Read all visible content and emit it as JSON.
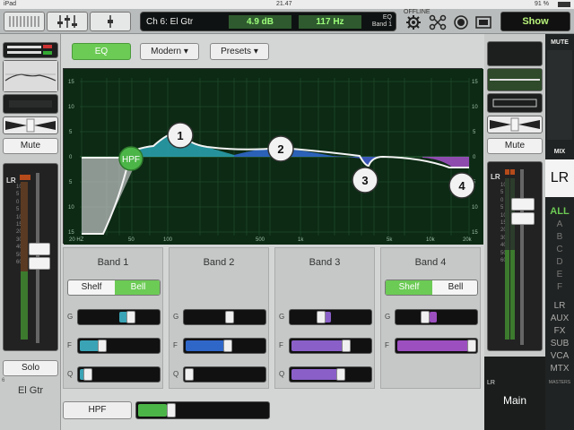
{
  "status_bar": {
    "device": "iPad",
    "time": "21.47",
    "battery": "91 %"
  },
  "top_bar": {
    "channel_name": "Ch 6: El Gtr",
    "gain": "4.9 dB",
    "frequency": "117 Hz",
    "eq_label": "EQ",
    "band_label": "Band 1",
    "offline": "OFFLINE",
    "show_label": "Show"
  },
  "left_strip": {
    "mute_label": "Mute",
    "meter_label": "LR",
    "solo_label": "Solo",
    "channel_number": "6",
    "channel_name": "El Gtr",
    "scale": [
      "10",
      "5",
      "0",
      "5",
      "10",
      "15",
      "20",
      "30",
      "40",
      "50",
      "60"
    ]
  },
  "eq_header": {
    "eq_label": "EQ",
    "mode_label": "Modern",
    "presets_label": "Presets"
  },
  "graph": {
    "y_ticks": [
      "15",
      "10",
      "5",
      "0",
      "5",
      "10",
      "15"
    ],
    "x_ticks": [
      "20 HZ",
      "50",
      "100",
      "500",
      "1k",
      "5k",
      "10k",
      "20k"
    ],
    "hpf_marker": "HPF",
    "markers": [
      "1",
      "2",
      "3",
      "4"
    ]
  },
  "bands": [
    {
      "title": "Band 1",
      "shelf_label": "Shelf",
      "bell_label": "Bell",
      "active": "bell",
      "gain_level": 0.58,
      "freq_level": 0.28,
      "q_level": 0.08,
      "color": "#3aa3b5"
    },
    {
      "title": "Band 2",
      "shelf_label": "",
      "bell_label": "",
      "active": "",
      "gain_level": 0.55,
      "freq_level": 0.5,
      "q_level": 0.05,
      "color": "#2f67c9"
    },
    {
      "title": "Band 3",
      "shelf_label": "",
      "bell_label": "",
      "active": "",
      "gain_level": 0.42,
      "freq_level": 0.64,
      "q_level": 0.6,
      "color": "#8a5fc8"
    },
    {
      "title": "Band 4",
      "shelf_label": "Shelf",
      "bell_label": "Bell",
      "active": "shelf",
      "gain_level": 0.42,
      "freq_level": 0.95,
      "q_level": 0,
      "color": "#9c4fbf"
    }
  ],
  "param_labels": {
    "g": "G",
    "f": "F",
    "q": "Q"
  },
  "bottom": {
    "hpf_label": "HPF",
    "hpf_level": 0.28
  },
  "right_strip": {
    "mute_label": "Mute",
    "meter_label": "LR",
    "bus_name": "LR",
    "main_label": "Main"
  },
  "mix_panel": {
    "mute_label": "MUTE",
    "mix_label": "MIX",
    "lr_label": "LR",
    "mix_items": [
      "ALL",
      "A",
      "B",
      "C",
      "D",
      "E",
      "F"
    ],
    "bottom_items": [
      "LR",
      "AUX",
      "FX",
      "SUB",
      "VCA",
      "MTX"
    ],
    "masters_label": "MASTERS"
  },
  "colors": {
    "accent_green": "#6ccb55",
    "readout_green": "#9dff7a",
    "graph_bg": "#0c2a14"
  }
}
